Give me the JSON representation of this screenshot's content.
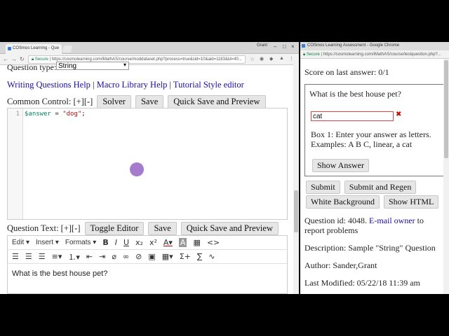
{
  "left_window": {
    "tab_title": "COSmos Learning - Que",
    "user": "Grant",
    "window_controls": [
      "–",
      "□",
      "×"
    ],
    "url_secure": "Secure",
    "url": "https://cosmolearning.com/iMathAS/course/moddataset.php?process=true&cid=10&aid=1183&id=40...",
    "question_type_label": "Question type:",
    "question_type_value": "String",
    "help_links": [
      "Writing Questions Help",
      "Macro Library Help",
      "Tutorial Style editor"
    ],
    "help_separator": " | ",
    "common_control_label": "Common Control: [+][-]",
    "common_buttons": [
      "Solver",
      "Save",
      "Quick Save and Preview"
    ],
    "code_line_number": "1",
    "code_var": "$answer",
    "code_op": " = ",
    "code_str": "\"dog\"",
    "code_end": ";",
    "question_text_label": "Question Text: [+][-]",
    "question_buttons": [
      "Toggle Editor",
      "Save",
      "Quick Save and Preview"
    ],
    "editor_menus": [
      "Edit ▾",
      "Insert ▾",
      "Formats ▾"
    ],
    "editor_body": "What is the best house pet?"
  },
  "right_window": {
    "title": "COSmos Learning Assessment - Google Chrome",
    "url_secure": "Secure",
    "url": "https://cosmolearning.com/iMathAS/course/testquestion.php?...",
    "score": "Score on last answer: 0/1",
    "question": "What is the best house pet?",
    "answer_value": "cat",
    "wrong_mark": "✖",
    "box_instructions": "Box 1: Enter your answer as letters. Examples: A B C, linear, a cat",
    "show_answer": "Show Answer",
    "buttons_row1": [
      "Submit",
      "Submit and Regen"
    ],
    "buttons_row2": [
      "White Background",
      "Show HTML"
    ],
    "question_id_prefix": "Question id: 4048.",
    "email_owner": "E-mail owner",
    "question_id_suffix": "to report problems",
    "description": "Description: Sample \"String\" Question",
    "author": "Author: Sander,Grant",
    "last_modified": "Last Modified: 05/22/18 11:39 am"
  },
  "colors": {
    "link": "#1a0dab",
    "error_border": "#dd4444",
    "cursor_highlight": "#9b6dc8",
    "code_variable": "#008855",
    "code_string": "#aa1111"
  }
}
